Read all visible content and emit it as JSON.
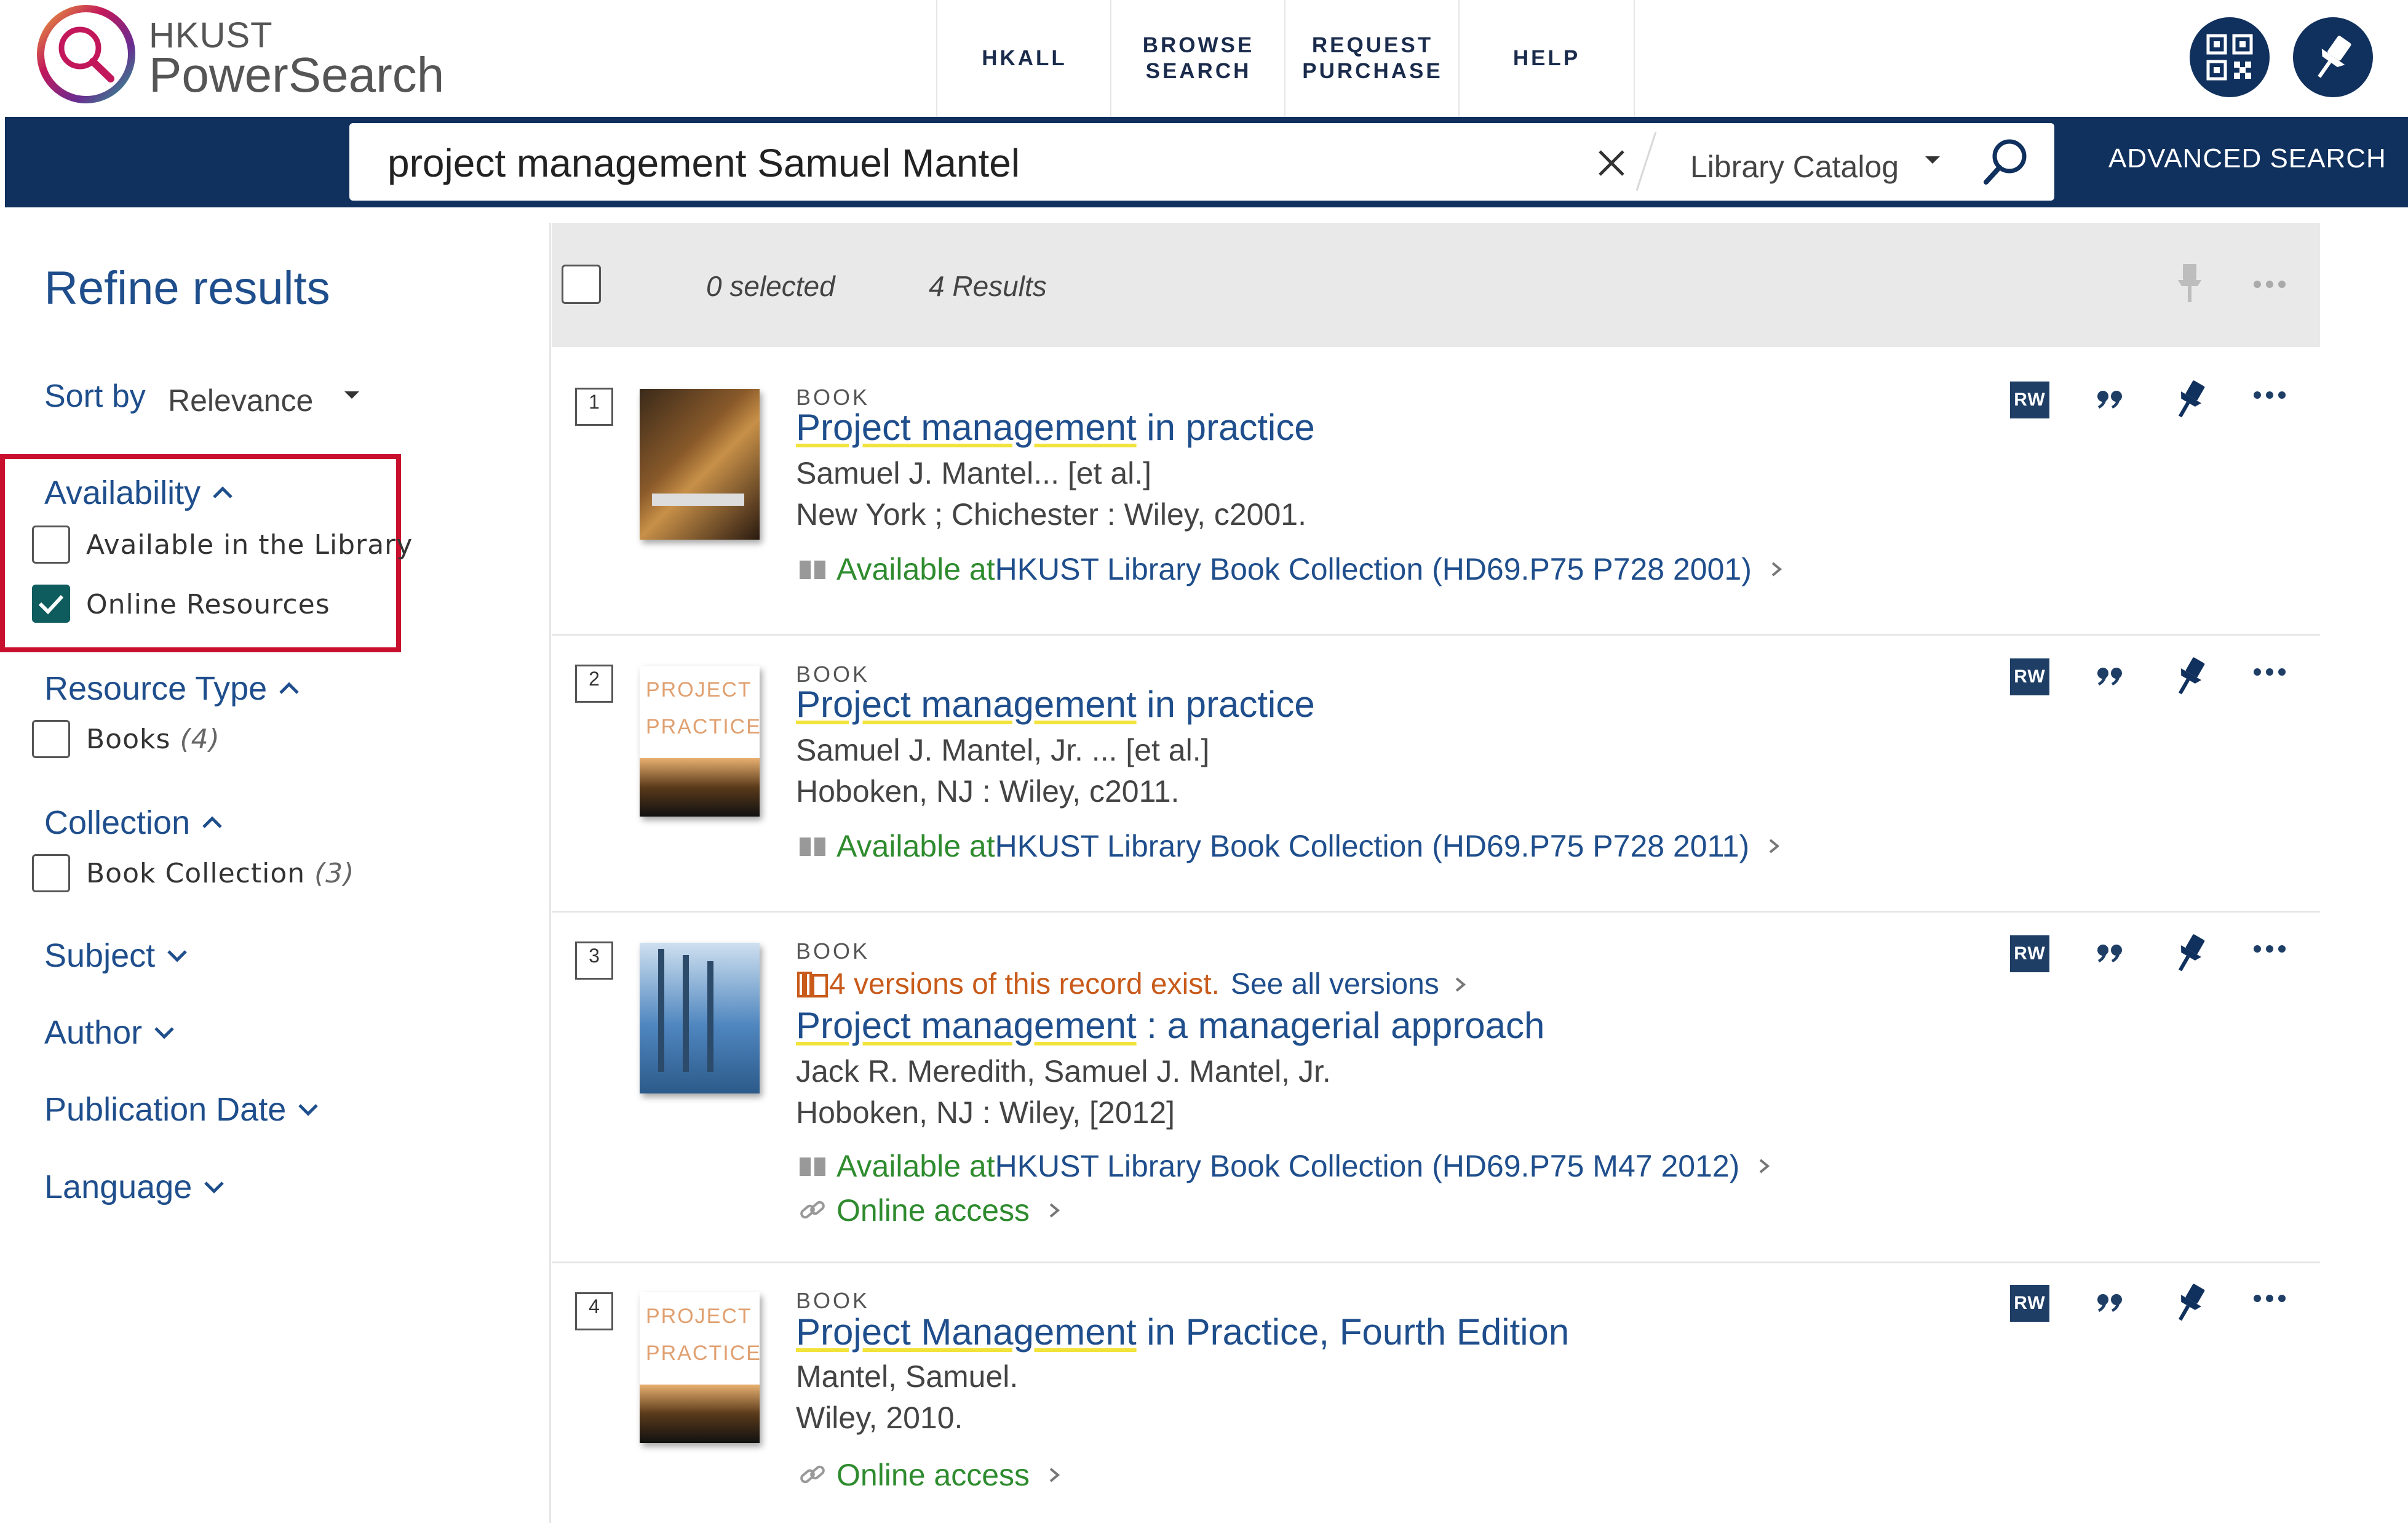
{
  "header": {
    "logo_line1": "HKUST",
    "logo_line2": "PowerSearch",
    "nav": [
      {
        "label": "HKALL"
      },
      {
        "label": "BROWSE\nSEARCH"
      },
      {
        "label": "REQUEST\nPURCHASE"
      },
      {
        "label": "HELP"
      }
    ]
  },
  "search": {
    "query": "project management Samuel Mantel",
    "scope": "Library Catalog",
    "advanced_label": "ADVANCED SEARCH"
  },
  "sidebar": {
    "title": "Refine results",
    "sort_label": "Sort by",
    "sort_value": "Relevance",
    "availability": {
      "heading": "Availability",
      "options": [
        {
          "label": "Available in the Library",
          "checked": false
        },
        {
          "label": "Online Resources",
          "checked": true
        }
      ]
    },
    "resource_type": {
      "heading": "Resource Type",
      "options": [
        {
          "label": "Books",
          "count": "(4)",
          "checked": false
        }
      ]
    },
    "collection": {
      "heading": "Collection",
      "options": [
        {
          "label": "Book Collection",
          "count": "(3)",
          "checked": false
        }
      ]
    },
    "collapsed_facets": [
      "Subject",
      "Author",
      "Publication Date",
      "Language"
    ]
  },
  "results_header": {
    "selected": "0 selected",
    "count": "4 Results"
  },
  "results": [
    {
      "index": "1",
      "type": "BOOK",
      "title_hl": "Project management",
      "title_rest": " in practice",
      "authors": "Samuel J. Mantel... [et al.]",
      "publication": "New York ; Chichester : Wiley, c2001.",
      "avail_label": "Available at ",
      "avail_location": "HKUST Library  Book Collection (HD69.P75 P728 2001)"
    },
    {
      "index": "2",
      "type": "BOOK",
      "title_hl": "Project management",
      "title_rest": " in practice",
      "authors": "Samuel J. Mantel, Jr. ... [et al.]",
      "publication": "Hoboken, NJ : Wiley, c2011.",
      "avail_label": "Available at ",
      "avail_location": "HKUST Library  Book Collection (HD69.P75 P728 2011)"
    },
    {
      "index": "3",
      "type": "BOOK",
      "versions_text": "4 versions of this record exist.",
      "versions_link": "See all versions",
      "title_hl": "Project management",
      "title_rest": " : a managerial approach",
      "authors": "Jack R. Meredith, Samuel J. Mantel, Jr.",
      "publication": "Hoboken, NJ : Wiley, [2012]",
      "avail_label": "Available at ",
      "avail_location": "HKUST Library  Book Collection (HD69.P75 M47 2012)",
      "online": "Online access"
    },
    {
      "index": "4",
      "type": "BOOK",
      "title_hl": "Project Management",
      "title_rest": " in Practice, Fourth Edition",
      "authors": "Mantel, Samuel.",
      "publication": "Wiley, 2010.",
      "online": "Online access"
    }
  ],
  "action_labels": {
    "rw": "RW"
  },
  "colors": {
    "brand_navy": "#10305d",
    "link_blue": "#1f4e8c",
    "available_green": "#2e8b2e",
    "highlight_yellow": "#f2e33b",
    "checkbox_teal": "#0e5c5e",
    "annotation_red": "#c8102e",
    "versions_orange": "#c85a1a"
  },
  "icons": [
    "logo-magnifier-icon",
    "qr-code-icon",
    "pin-icon",
    "close-icon",
    "caret-down-icon",
    "search-icon",
    "chevron-up-icon",
    "chevron-down-icon",
    "check-icon",
    "pin-icon",
    "more-icon",
    "quote-icon",
    "book-icon",
    "link-icon",
    "chevron-right-icon",
    "versions-icon"
  ]
}
